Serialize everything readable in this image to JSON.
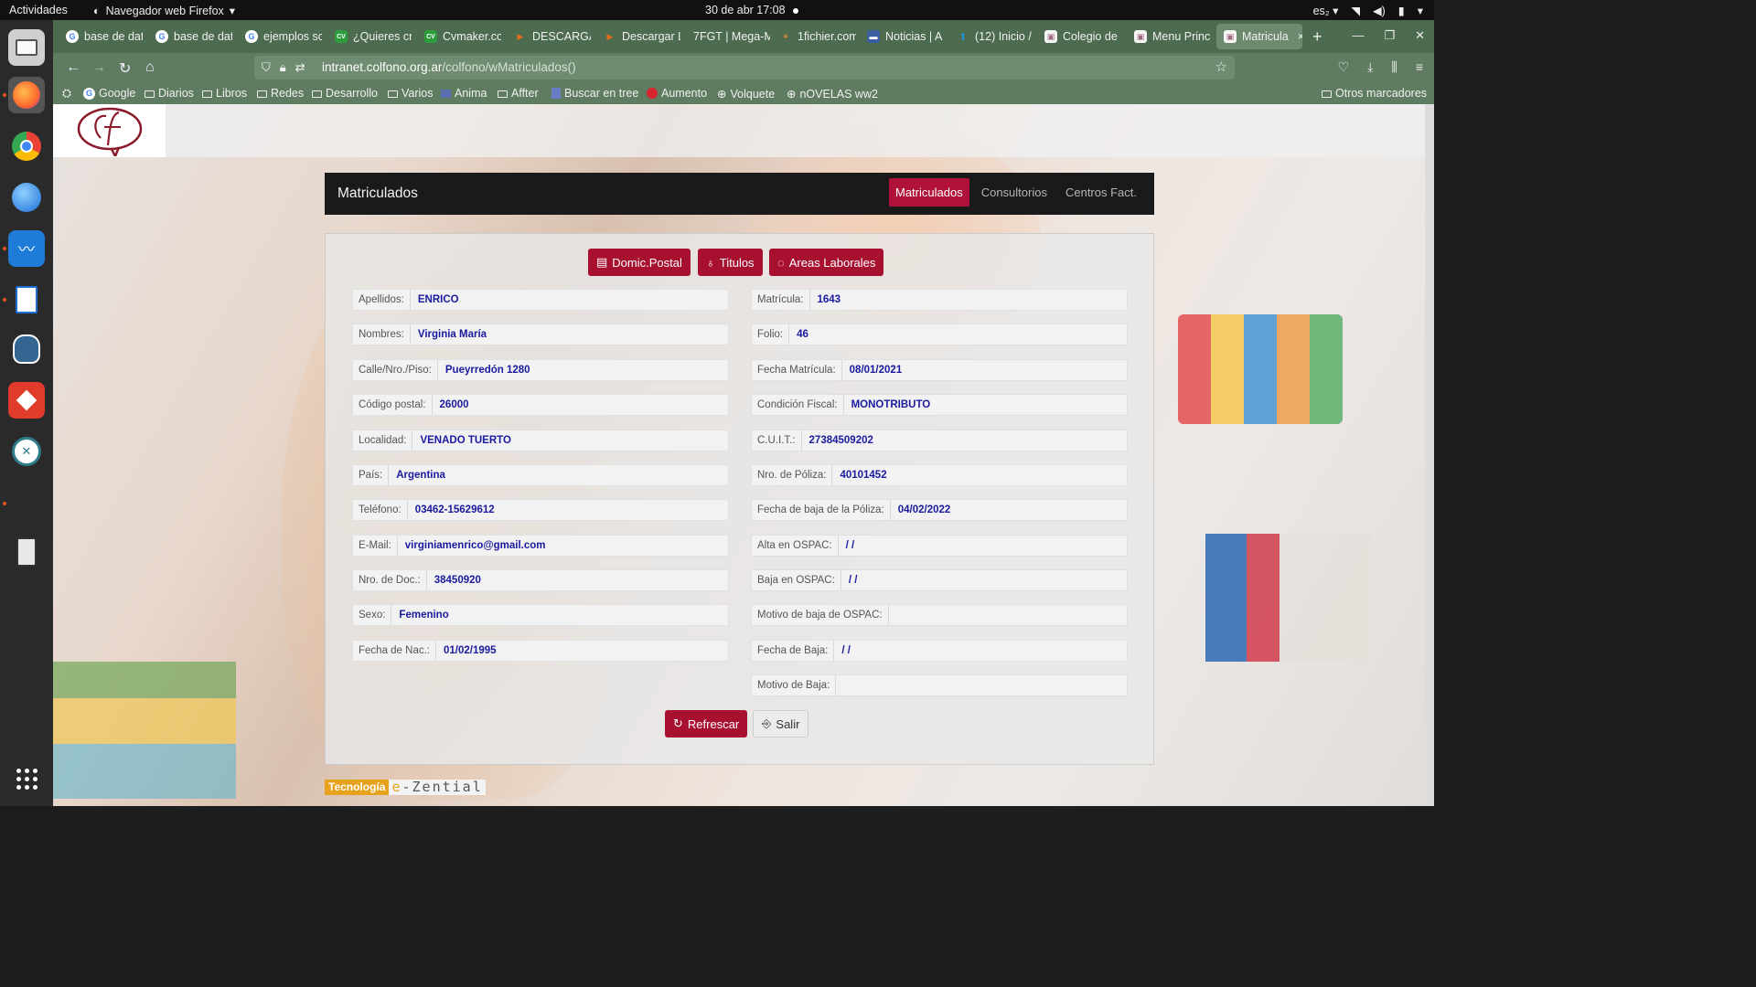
{
  "system": {
    "activities": "Actividades",
    "app_name": "Navegador web Firefox",
    "clock": "30 de abr  17:08",
    "lang": "es₂"
  },
  "browser": {
    "tabs": [
      {
        "label": "base de dat",
        "fav": "G",
        "fav_color": "#4d6b4f"
      },
      {
        "label": "base de dat",
        "fav": "G",
        "fav_color": "#4d6b4f"
      },
      {
        "label": "ejemplos sc",
        "fav": "G",
        "fav_color": "#4d6b4f"
      },
      {
        "label": "¿Quieres cr",
        "fav": "CV",
        "fav_color": "#2d9c3c"
      },
      {
        "label": "Cvmaker.co",
        "fav": "CV",
        "fav_color": "#2d9c3c"
      },
      {
        "label": "DESCARGA",
        "fav": "▶",
        "fav_color": "#e46c1b"
      },
      {
        "label": "Descargar L",
        "fav": "▶",
        "fav_color": "#e46c1b"
      },
      {
        "label": "7FGT | Mega-M",
        "fav": "",
        "fav_color": "#4d6b4f"
      },
      {
        "label": "1fichier.com",
        "fav": "✶",
        "fav_color": "#c0542a"
      },
      {
        "label": "Noticias | A",
        "fav": "▬",
        "fav_color": "#3b5fa0"
      },
      {
        "label": "(12) Inicio /",
        "fav": "t",
        "fav_color": "#1d9bf0"
      },
      {
        "label": "Colegio de",
        "fav": "▣",
        "fav_color": "#c9a7b3"
      },
      {
        "label": "Menu Princ",
        "fav": "▣",
        "fav_color": "#c9a7b3"
      },
      {
        "label": "Matricula",
        "fav": "▣",
        "fav_color": "#c9a7b3"
      }
    ],
    "url_domain": "intranet.colfono.org.ar",
    "url_path": "/colfono/wMatriculados()",
    "bookmarks": [
      {
        "label": "Google",
        "kind": "google"
      },
      {
        "label": "Diarios",
        "kind": "folder"
      },
      {
        "label": "Libros",
        "kind": "folder"
      },
      {
        "label": "Redes",
        "kind": "folder"
      },
      {
        "label": "Desarrollo",
        "kind": "folder"
      },
      {
        "label": "Varios",
        "kind": "folder"
      },
      {
        "label": "Anima",
        "kind": "site"
      },
      {
        "label": "Affter",
        "kind": "folder"
      },
      {
        "label": "Buscar en tree",
        "kind": "site"
      },
      {
        "label": "Aumento",
        "kind": "site"
      },
      {
        "label": "Volquete",
        "kind": "globe"
      },
      {
        "label": "nOVELAS ww2",
        "kind": "globe"
      }
    ],
    "other_bookmarks": "Otros marcadores"
  },
  "header": {
    "title": "Matriculados",
    "nav": [
      "Matriculados",
      "Consultorios",
      "Centros Fact."
    ]
  },
  "actions": {
    "domic": "Domic.Postal",
    "titulos": "Titulos",
    "areas": "Areas Laborales",
    "refresh": "Refrescar",
    "exit": "Salir"
  },
  "left_fields": [
    {
      "label": "Apellidos:",
      "value": "ENRICO"
    },
    {
      "label": "Nombres:",
      "value": "Virginia María"
    },
    {
      "label": "Calle/Nro./Piso:",
      "value": "Pueyrredón 1280"
    },
    {
      "label": "Código postal:",
      "value": "26000"
    },
    {
      "label": "Localidad:",
      "value": "VENADO TUERTO"
    },
    {
      "label": "País:",
      "value": "Argentina"
    },
    {
      "label": "Teléfono:",
      "value": "03462-15629612"
    },
    {
      "label": "E-Mail:",
      "value": "virginiamenrico@gmail.com"
    },
    {
      "label": "Nro. de Doc.:",
      "value": "38450920"
    },
    {
      "label": "Sexo:",
      "value": "Femenino"
    },
    {
      "label": "Fecha de Nac.:",
      "value": "01/02/1995"
    }
  ],
  "right_fields": [
    {
      "label": "Matrícula:",
      "value": "1643"
    },
    {
      "label": "Folio:",
      "value": "46"
    },
    {
      "label": "Fecha Matrícula:",
      "value": "08/01/2021"
    },
    {
      "label": "Condición Fiscal:",
      "value": "MONOTRIBUTO"
    },
    {
      "label": "C.U.I.T.:",
      "value": "27384509202"
    },
    {
      "label": "Nro. de Póliza:",
      "value": "40101452"
    },
    {
      "label": "Fecha de baja de la Póliza:",
      "value": "04/02/2022"
    },
    {
      "label": "Alta en OSPAC:",
      "value": " /  /"
    },
    {
      "label": "Baja en OSPAC:",
      "value": " /  /"
    },
    {
      "label": "Motivo de baja de OSPAC:",
      "value": ""
    },
    {
      "label": "Fecha de Baja:",
      "value": "/  /"
    },
    {
      "label": "Motivo de Baja:",
      "value": ""
    }
  ],
  "footer": {
    "left": "Tecnología",
    "right_e": "e",
    "right_rest": "-Zential"
  }
}
